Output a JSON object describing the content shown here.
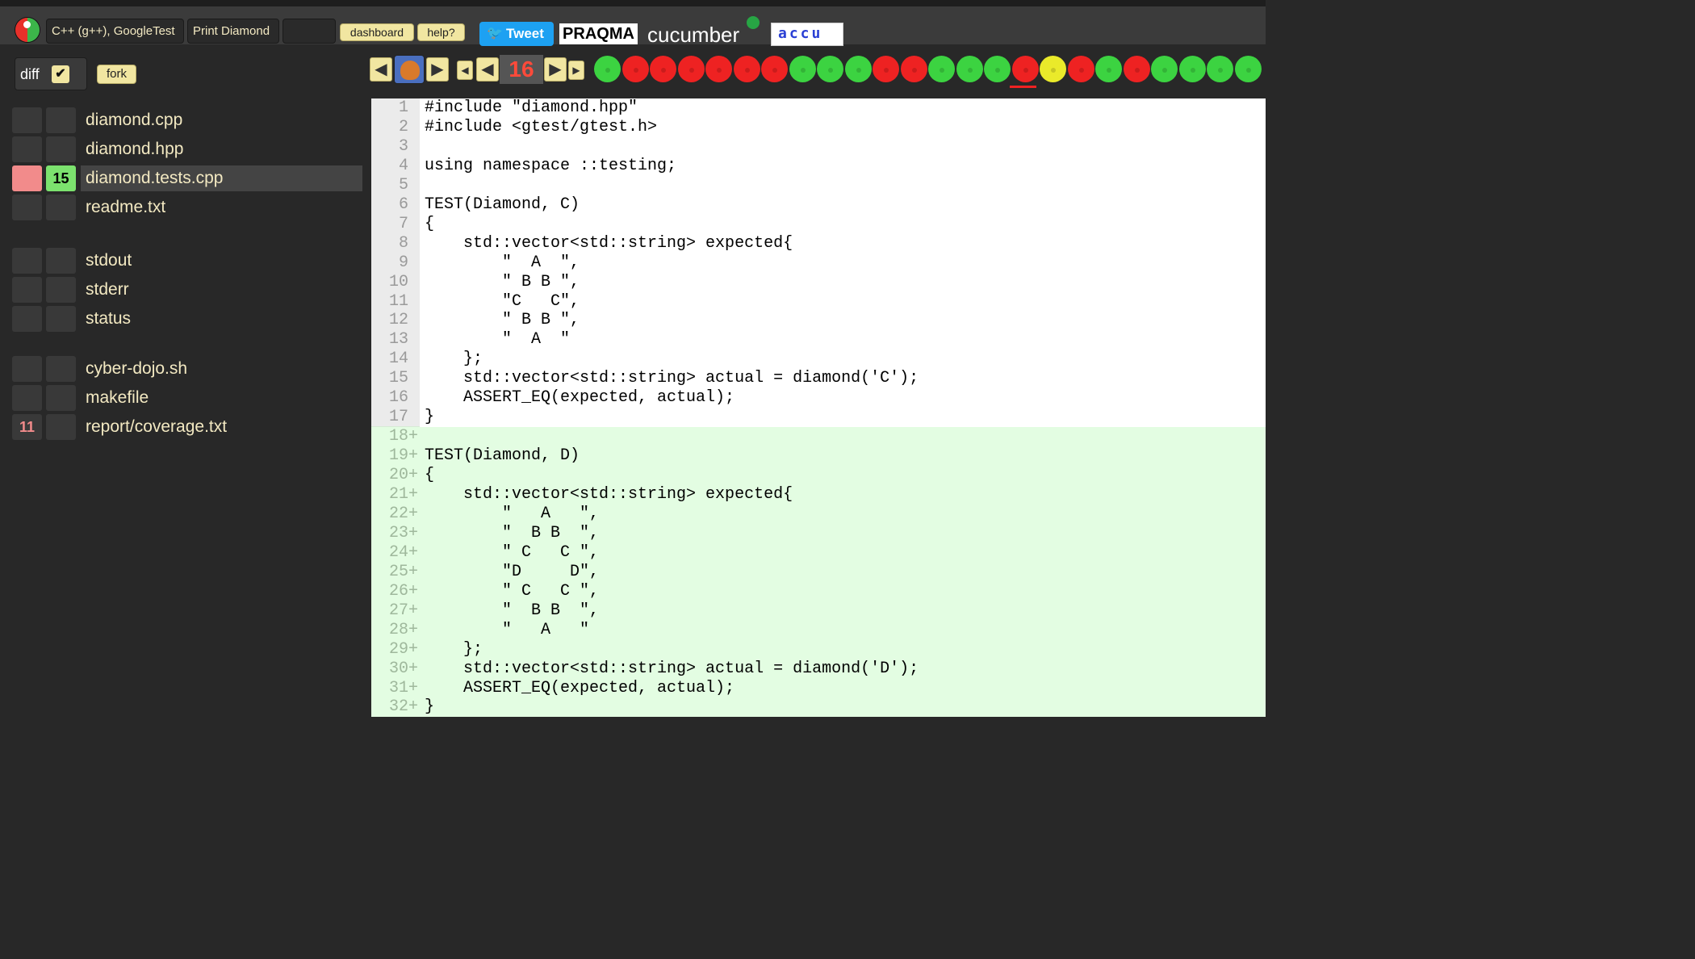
{
  "topbar": {
    "language": "C++ (g++), GoogleTest",
    "exercise": "Print Diamond",
    "dashboard": "dashboard",
    "help": "help?",
    "tweet": "Tweet",
    "praqma": "PRAQMA",
    "cucumber": "cucumber",
    "accu": "accu"
  },
  "controls": {
    "diff_label": "diff",
    "diff_checked": "✔",
    "fork": "fork",
    "current_light": "16"
  },
  "files": [
    {
      "name": "diamond.cpp"
    },
    {
      "name": "diamond.hpp"
    },
    {
      "name": "diamond.tests.cpp",
      "added": "15"
    },
    {
      "name": "readme.txt"
    },
    {
      "name": "stdout"
    },
    {
      "name": "stderr"
    },
    {
      "name": "status"
    },
    {
      "name": "cyber-dojo.sh"
    },
    {
      "name": "makefile"
    },
    {
      "name": "report/coverage.txt",
      "deleted": "11"
    }
  ],
  "traffic_lights": [
    "green",
    "red",
    "red",
    "red",
    "red",
    "red",
    "red",
    "green",
    "green",
    "green",
    "red",
    "red",
    "green",
    "green",
    "green",
    "red",
    "amber",
    "red",
    "green",
    "red",
    "green",
    "green",
    "green",
    "green"
  ],
  "colors": {
    "green": "#3cd341",
    "red": "#ee2222",
    "amber": "#eaea2a"
  },
  "code_lines": [
    {
      "n": "1",
      "text": "#include \"diamond.hpp\""
    },
    {
      "n": "2",
      "text": "#include <gtest/gtest.h>"
    },
    {
      "n": "3",
      "text": ""
    },
    {
      "n": "4",
      "text": "using namespace ::testing;"
    },
    {
      "n": "5",
      "text": ""
    },
    {
      "n": "6",
      "text": "TEST(Diamond, C)"
    },
    {
      "n": "7",
      "text": "{"
    },
    {
      "n": "8",
      "text": "    std::vector<std::string> expected{"
    },
    {
      "n": "9",
      "text": "        \"  A  \","
    },
    {
      "n": "10",
      "text": "        \" B B \","
    },
    {
      "n": "11",
      "text": "        \"C   C\","
    },
    {
      "n": "12",
      "text": "        \" B B \","
    },
    {
      "n": "13",
      "text": "        \"  A  \""
    },
    {
      "n": "14",
      "text": "    };"
    },
    {
      "n": "15",
      "text": "    std::vector<std::string> actual = diamond('C');"
    },
    {
      "n": "16",
      "text": "    ASSERT_EQ(expected, actual);"
    },
    {
      "n": "17",
      "text": "}"
    },
    {
      "n": "18",
      "text": "",
      "added": true
    },
    {
      "n": "19",
      "text": "TEST(Diamond, D)",
      "added": true
    },
    {
      "n": "20",
      "text": "{",
      "added": true
    },
    {
      "n": "21",
      "text": "    std::vector<std::string> expected{",
      "added": true
    },
    {
      "n": "22",
      "text": "        \"   A   \",",
      "added": true
    },
    {
      "n": "23",
      "text": "        \"  B B  \",",
      "added": true
    },
    {
      "n": "24",
      "text": "        \" C   C \",",
      "added": true
    },
    {
      "n": "25",
      "text": "        \"D     D\",",
      "added": true
    },
    {
      "n": "26",
      "text": "        \" C   C \",",
      "added": true
    },
    {
      "n": "27",
      "text": "        \"  B B  \",",
      "added": true
    },
    {
      "n": "28",
      "text": "        \"   A   \"",
      "added": true
    },
    {
      "n": "29",
      "text": "    };",
      "added": true
    },
    {
      "n": "30",
      "text": "    std::vector<std::string> actual = diamond('D');",
      "added": true
    },
    {
      "n": "31",
      "text": "    ASSERT_EQ(expected, actual);",
      "added": true
    },
    {
      "n": "32",
      "text": "}",
      "added": true
    }
  ]
}
